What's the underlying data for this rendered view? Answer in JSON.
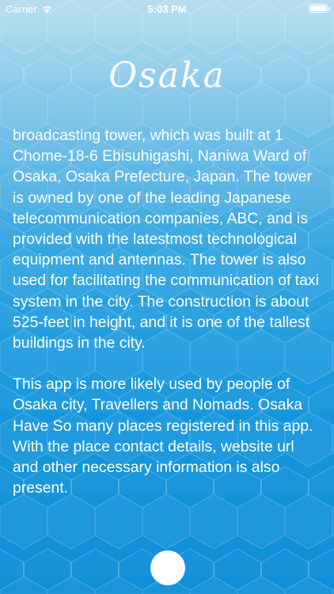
{
  "status_bar": {
    "carrier": "Carrier",
    "time": "5:03 PM",
    "wifi_icon": "wifi-icon",
    "battery_icon": "battery-icon"
  },
  "header": {
    "title": "Osaka"
  },
  "description": {
    "paragraphs": [
      "broadcasting tower, which was built at 1 Chome-18-6 Ebisuhigashi, Naniwa Ward of Osaka, Osaka Prefecture, Japan. The tower is owned by one of the leading Japanese telecommunication companies, ABC, and is provided with the latestmost technological equipment and antennas. The tower is also used for facilitating the communication of taxi system in the city. The construction is about 525-feet in height, and it is one of the tallest buildings in the city.",
      "This app is more likely used by people of Osaka city, Travellers and Nomads. Osaka Have So many places registered in this app. With the place contact details, website url and other necessary information is also present."
    ]
  },
  "colors": {
    "background_top": "#8fcbe6",
    "background_bottom": "#0f8fd8",
    "text": "#ffffff"
  }
}
